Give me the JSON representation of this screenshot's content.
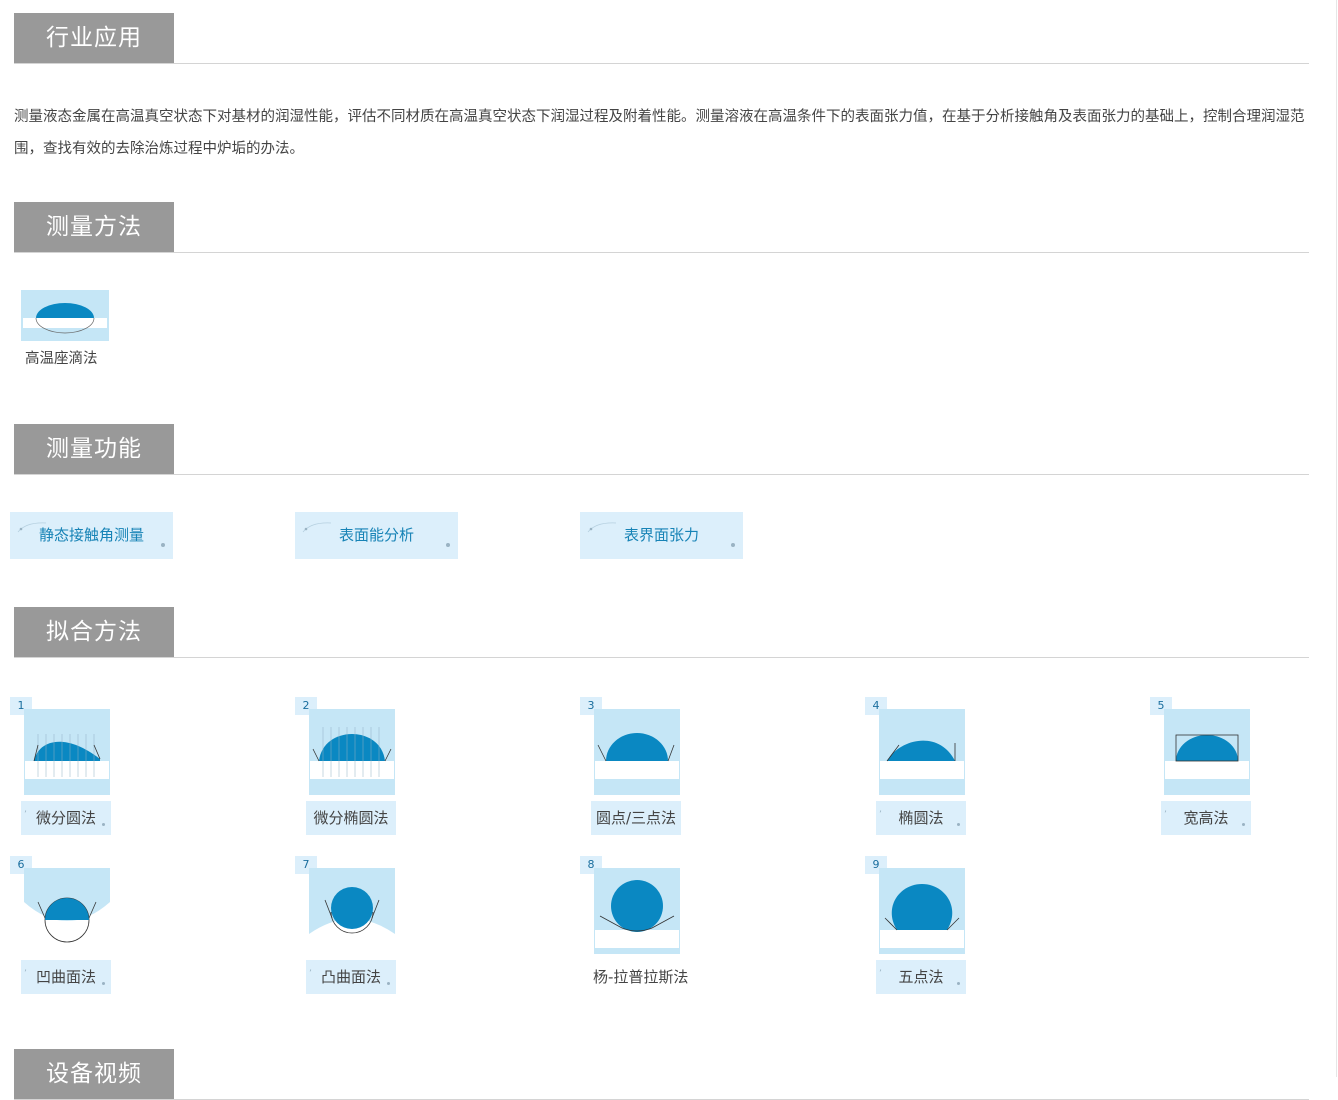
{
  "sections": {
    "industry": "行业应用",
    "method": "测量方法",
    "function": "测量功能",
    "fitting": "拟合方法",
    "video": "设备视频"
  },
  "intro": "测量液态金属在高温真空状态下对基材的润湿性能，评估不同材质在高温真空状态下润湿过程及附着性能。测量溶液在高温条件下的表面张力值，在基于分析接触角及表面张力的基础上，控制合理润湿范围，查找有效的去除治炼过程中炉垢的办法。",
  "methods": [
    {
      "label": "高温座滴法",
      "icon": "sessile-drop-icon"
    }
  ],
  "functions": [
    {
      "label": "静态接触角测量"
    },
    {
      "label": "表面能分析"
    },
    {
      "label": "表界面张力"
    }
  ],
  "fitting_methods": [
    {
      "num": "1",
      "label": "微分圆法",
      "icon": "differential-circle-icon"
    },
    {
      "num": "2",
      "label": "微分椭圆法",
      "icon": "differential-ellipse-icon"
    },
    {
      "num": "3",
      "label": "圆点/三点法",
      "icon": "three-point-icon"
    },
    {
      "num": "4",
      "label": "椭圆法",
      "icon": "ellipse-icon"
    },
    {
      "num": "5",
      "label": "宽高法",
      "icon": "width-height-icon"
    },
    {
      "num": "6",
      "label": "凹曲面法",
      "icon": "concave-surface-icon"
    },
    {
      "num": "7",
      "label": "凸曲面法",
      "icon": "convex-surface-icon"
    },
    {
      "num": "8",
      "label": "杨-拉普拉斯法",
      "icon": "young-laplace-icon"
    },
    {
      "num": "9",
      "label": "五点法",
      "icon": "five-point-icon"
    }
  ],
  "colors": {
    "section_bg": "#999999",
    "chip_bg": "#dceffb",
    "chip_text": "#1783b6",
    "drop": "#0a88c2",
    "thumb_bg": "#c5e6f6"
  }
}
